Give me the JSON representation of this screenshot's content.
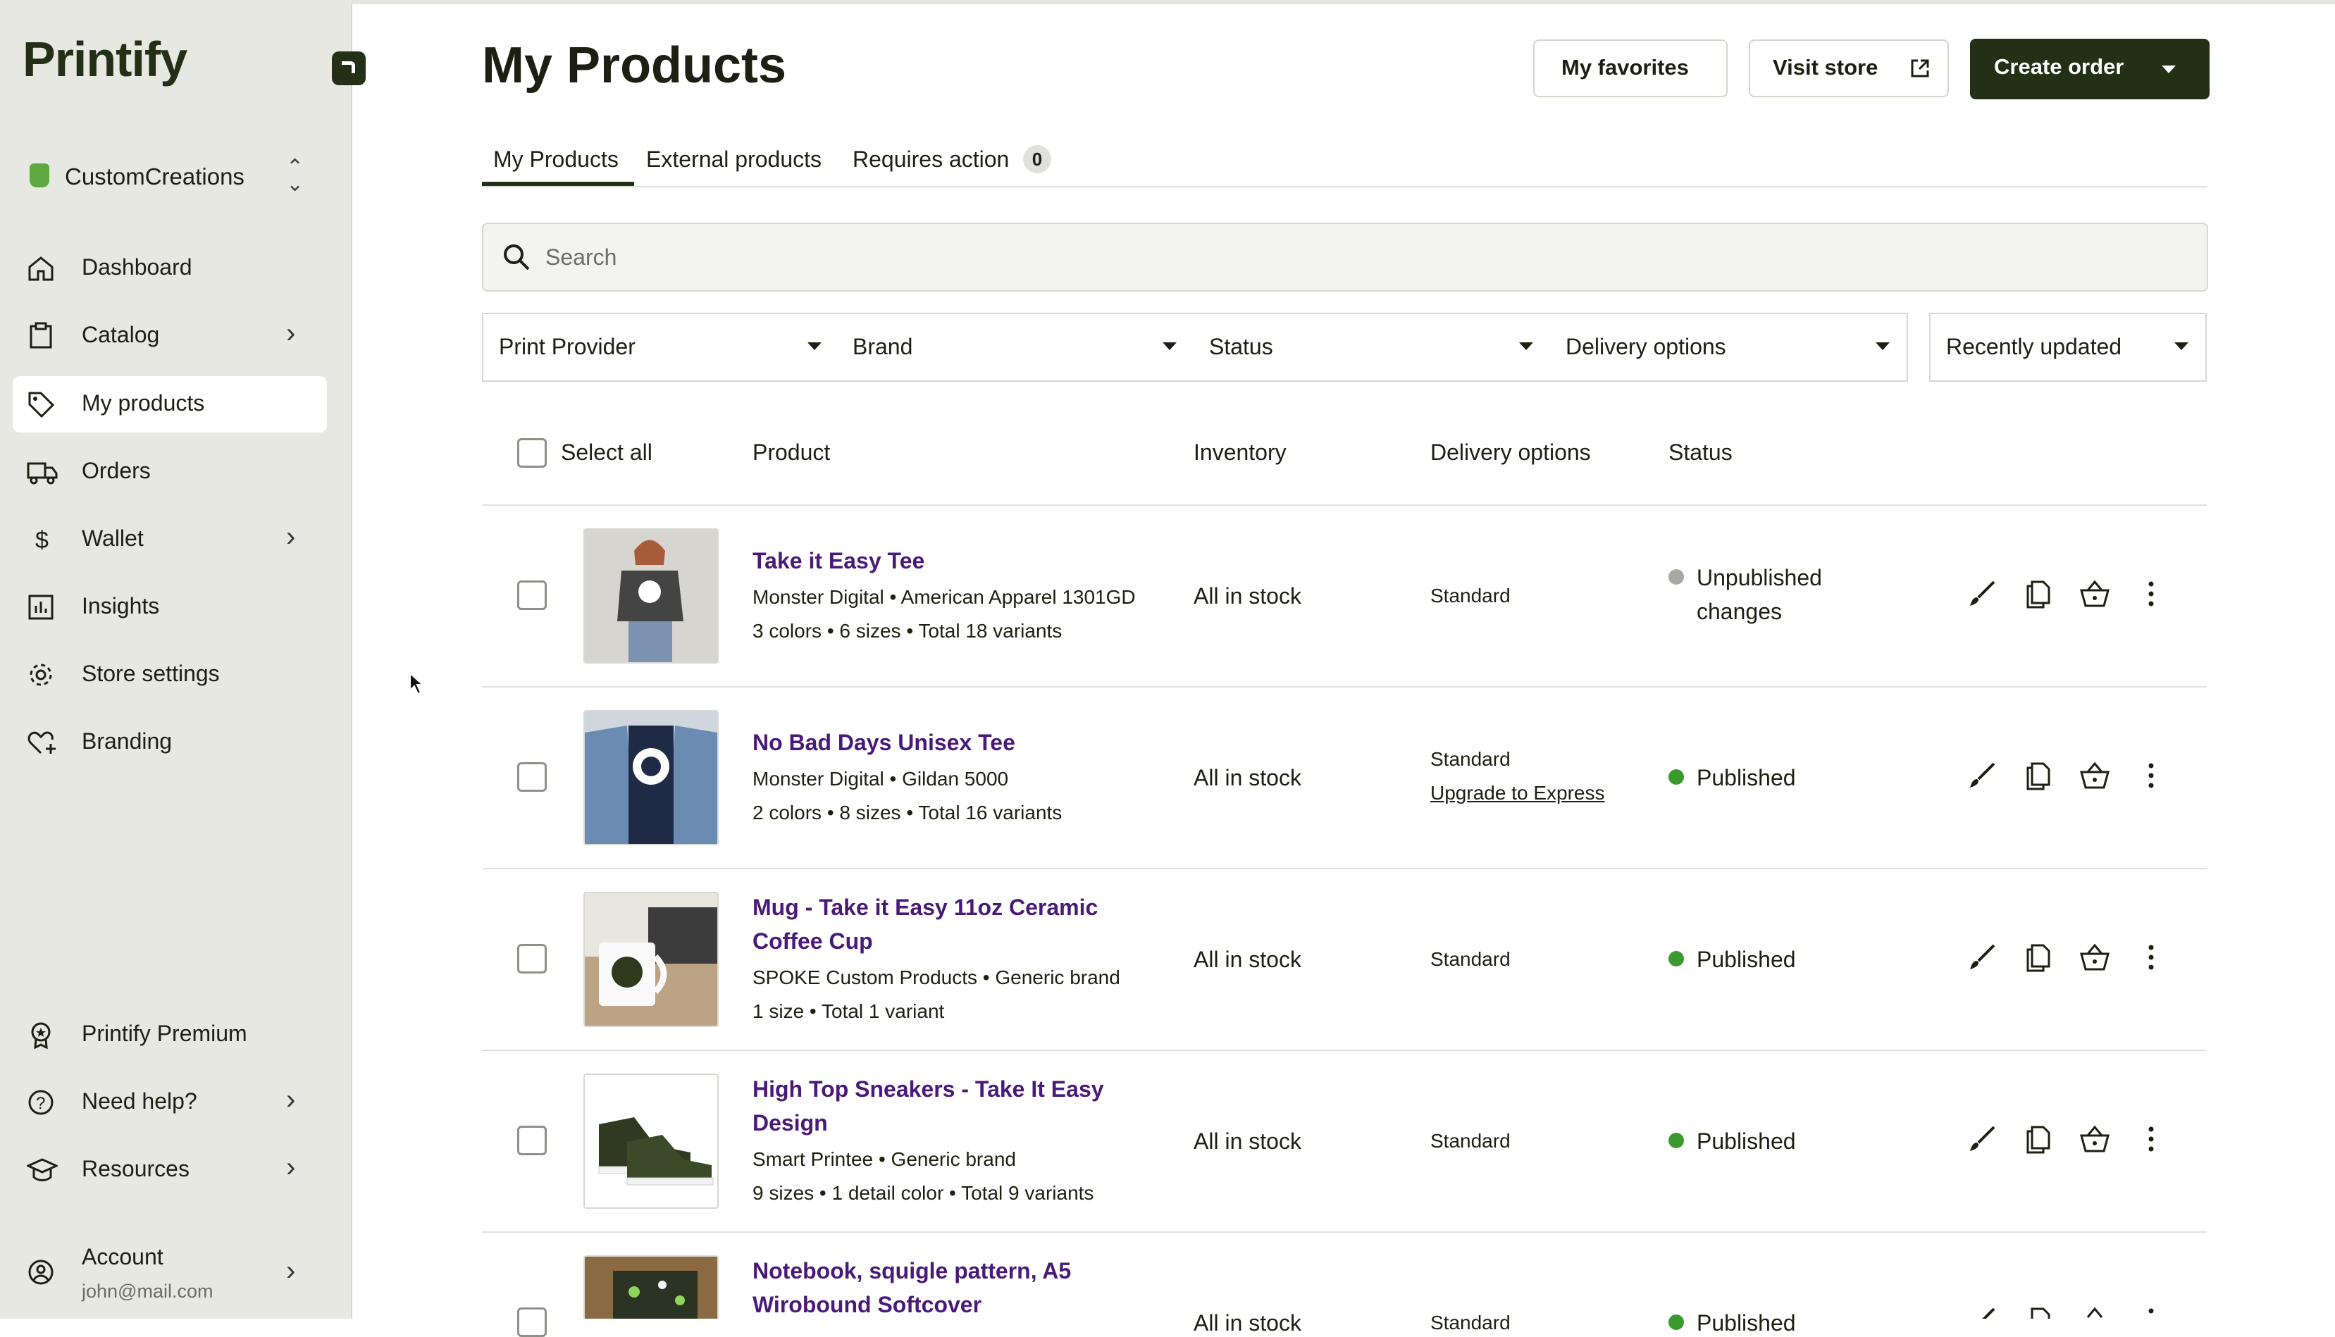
{
  "app": {
    "logo": "Printify"
  },
  "sidebar": {
    "store": "CustomCreations",
    "items": [
      {
        "label": "Dashboard"
      },
      {
        "label": "Catalog"
      },
      {
        "label": "My products"
      },
      {
        "label": "Orders"
      },
      {
        "label": "Wallet"
      },
      {
        "label": "Insights"
      },
      {
        "label": "Store settings"
      },
      {
        "label": "Branding"
      }
    ],
    "bottom": [
      {
        "label": "Printify Premium"
      },
      {
        "label": "Need help?"
      },
      {
        "label": "Resources"
      }
    ],
    "account": {
      "label": "Account",
      "email": "john@mail.com"
    }
  },
  "header": {
    "title": "My Products",
    "favorites": "My favorites",
    "visit_store": "Visit store",
    "create_order": "Create order"
  },
  "tabs": [
    {
      "label": "My Products"
    },
    {
      "label": "External products"
    },
    {
      "label": "Requires action",
      "count": "0"
    }
  ],
  "search": {
    "placeholder": "Search",
    "value": ""
  },
  "filters": {
    "print_provider": "Print Provider",
    "brand": "Brand",
    "status": "Status",
    "delivery": "Delivery options",
    "sort": "Recently updated"
  },
  "table": {
    "select_all": "Select all",
    "columns": {
      "product": "Product",
      "inventory": "Inventory",
      "delivery": "Delivery options",
      "status": "Status"
    },
    "rows": [
      {
        "name": "Take it Easy Tee",
        "provider": "Monster Digital • American Apparel 1301GD",
        "variants": "3 colors • 6 sizes • Total 18 variants",
        "inventory": "All in stock",
        "delivery": "Standard",
        "status_line1": "Unpublished",
        "status_line2": "changes"
      },
      {
        "name": "No Bad Days Unisex Tee",
        "provider": "Monster Digital • Gildan 5000",
        "variants": "2 colors • 8 sizes • Total 16 variants",
        "inventory": "All in stock",
        "delivery": "Standard",
        "upgrade": "Upgrade to Express",
        "status": "Published"
      },
      {
        "name_line1": "Mug - Take it Easy 11oz Ceramic",
        "name_line2": "Coffee Cup",
        "provider": "SPOKE Custom Products • Generic brand",
        "variants": "1 size • Total 1 variant",
        "inventory": "All in stock",
        "delivery": "Standard",
        "status": "Published"
      },
      {
        "name_line1": "High Top Sneakers - Take It Easy",
        "name_line2": "Design",
        "provider": "Smart Printee • Generic brand",
        "variants": "9 sizes • 1 detail color • Total 9 variants",
        "inventory": "All in stock",
        "delivery": "Standard",
        "status": "Published"
      },
      {
        "name_line1": "Notebook, squigle pattern, A5",
        "name_line2": "Wirobound Softcover",
        "inventory": "All in stock",
        "delivery": "Standard",
        "status": "Published"
      }
    ]
  },
  "colors": {
    "sidebar_bg": "#e7e8e2",
    "brand_dark": "#233016",
    "product_link": "#4a1a78",
    "published": "#3a9a30",
    "unpublished": "#a8aaa2"
  },
  "icons": [
    "home-icon",
    "catalog-icon",
    "tag-icon",
    "truck-icon",
    "dollar-icon",
    "insights-icon",
    "gear-icon",
    "heart-plus-icon",
    "premium-icon",
    "help-icon",
    "mortarboard-icon",
    "account-icon",
    "search-icon",
    "external-link-icon",
    "edit-icon",
    "copy-icon",
    "basket-icon",
    "more-icon",
    "cursor-icon"
  ]
}
